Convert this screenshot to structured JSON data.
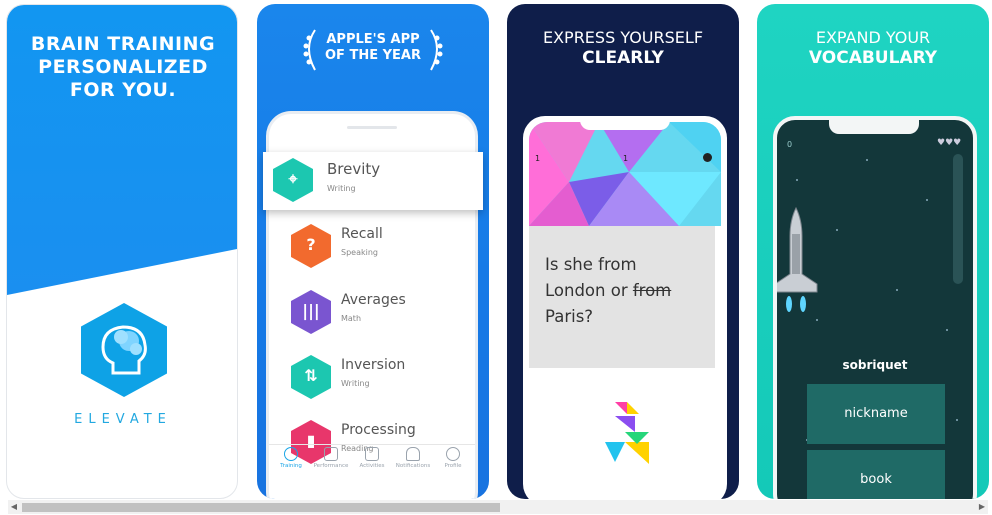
{
  "colors": {
    "primary_blue": "#1a8ff0",
    "dark_navy": "#0f1e4a",
    "teal": "#1fd4c2",
    "accent_cyan": "#22a8e0"
  },
  "cards": [
    {
      "headline_lines": [
        "BRAIN TRAINING",
        "PERSONALIZED",
        "FOR YOU."
      ],
      "logo_icon": "brain-head-icon",
      "brand": "ELEVATE"
    },
    {
      "award_lines": [
        "APPLE'S APP",
        "OF THE YEAR"
      ],
      "skills": [
        {
          "name": "Brevity",
          "category": "Writing",
          "color": "#1cc7b0",
          "icon": "target-icon"
        },
        {
          "name": "Recall",
          "category": "Speaking",
          "color": "#f26a2e",
          "icon": "question-icon"
        },
        {
          "name": "Averages",
          "category": "Math",
          "color": "#7a55d0",
          "icon": "bars-icon"
        },
        {
          "name": "Inversion",
          "category": "Writing",
          "color": "#1cc7b0",
          "icon": "arrows-icon"
        },
        {
          "name": "Processing",
          "category": "Reading",
          "color": "#e8366b",
          "icon": "book-icon"
        }
      ],
      "tabs": [
        "Training",
        "Performance",
        "Activities",
        "Notifications",
        "Profile"
      ]
    },
    {
      "headline_lines": [
        "EXPRESS YOURSELF",
        "CLEARLY"
      ],
      "status": {
        "left": "1",
        "middle": "1"
      },
      "question": {
        "line1": "Is she from",
        "line2_a": "London or ",
        "line2_struck": "from",
        "line3": "Paris?"
      }
    },
    {
      "headline_lines": [
        "EXPAND YOUR",
        "VOCABULARY"
      ],
      "status": {
        "score": "0",
        "lives": "♥♥♥"
      },
      "word": "sobriquet",
      "options": [
        "nickname",
        "book"
      ]
    }
  ]
}
